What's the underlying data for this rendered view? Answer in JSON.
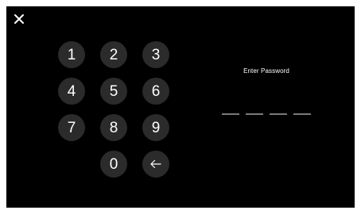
{
  "window": {
    "close_icon": "close-icon",
    "background": "#000000"
  },
  "keypad": {
    "keys": [
      {
        "label": "1"
      },
      {
        "label": "2"
      },
      {
        "label": "3"
      },
      {
        "label": "4"
      },
      {
        "label": "5"
      },
      {
        "label": "6"
      },
      {
        "label": "7"
      },
      {
        "label": "8"
      },
      {
        "label": "9"
      },
      {
        "label": "0"
      }
    ],
    "backspace_icon": "arrow-left-icon",
    "key_color": "#2b2b2b",
    "text_color": "#ffffff"
  },
  "password": {
    "prompt": "Enter Password",
    "pin_length": 4,
    "entered_digits": 0,
    "slot_color": "#7a7a7a"
  }
}
